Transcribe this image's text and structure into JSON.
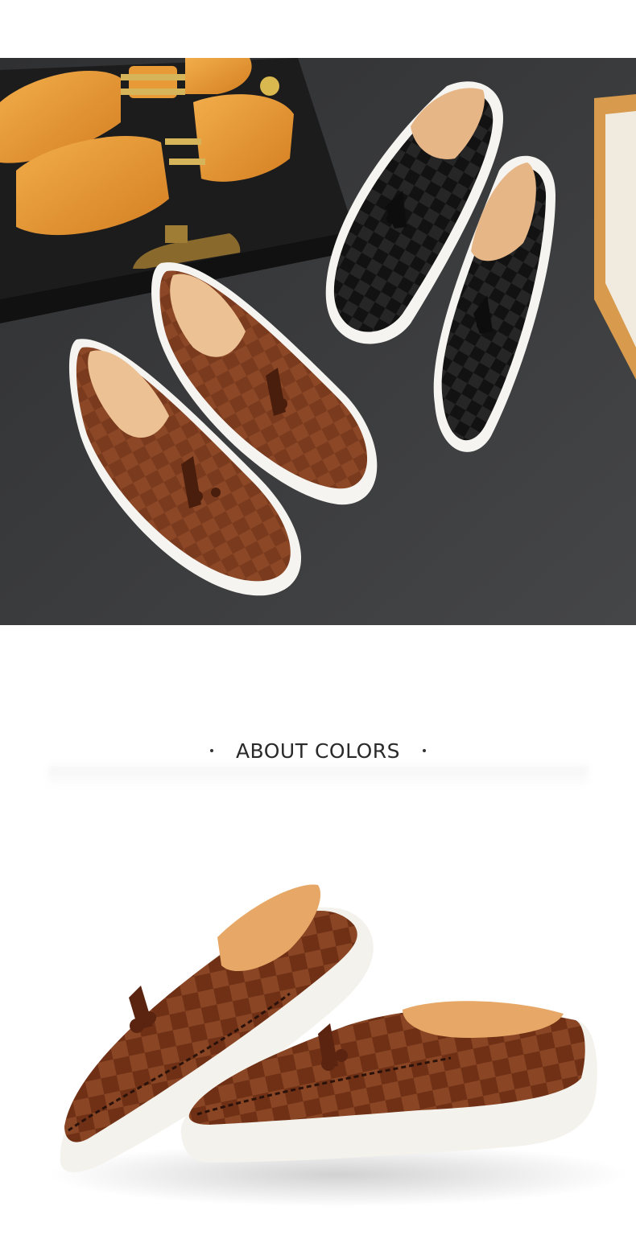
{
  "section_heading": {
    "title": "ABOUT COLORS"
  },
  "colors": {
    "floor": "#38393b",
    "brown_leather": "#7a3a1e",
    "black_leather": "#141414",
    "sole": "#f4f3ef",
    "lining": "#e9b98a",
    "shoe_tree_wood": "#e59a3a"
  }
}
